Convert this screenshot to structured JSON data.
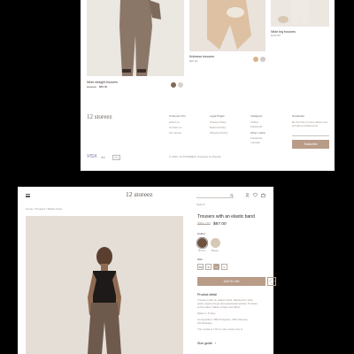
{
  "colors": {
    "accent": "#b89c88",
    "price_old": "#b2a89f",
    "text": "#3a3330"
  },
  "listing": {
    "products": [
      {
        "name": "Wide straight trousers",
        "price_old": "$100.00",
        "price": "$89.00",
        "swatches": [
          "#7d6a5a",
          "#d9d2c8"
        ]
      },
      {
        "name": "Knitwear trousers",
        "price": "$95.00",
        "swatches": [
          "#d8b48a",
          "#cfcac4"
        ]
      },
      {
        "name": "Wide leg trousers",
        "price": "$100.00"
      }
    ]
  },
  "footer": {
    "logo": "12 storeez",
    "cols": [
      {
        "title": "Customer info",
        "links": [
          "About us",
          "Contact us",
          "Our stores"
        ]
      },
      {
        "title": "Legal Pages",
        "links": [
          "Privacy Policy",
          "Refund Policy",
          "Shipping Policy"
        ]
      },
      {
        "title": "Instagram",
        "links": [
          "Twitter",
          "Facebook"
        ],
        "subtitle": "Other media",
        "sublinks": [
          "Facebook",
          "Youtube"
        ]
      },
      {
        "title": "Newsletter",
        "text": "Be the first to know about new arrivals and discounts",
        "placeholder": "Enter email",
        "button": "Subscribe"
      }
    ],
    "payments": [
      "VISA",
      "●●",
      "Pay"
    ],
    "copyright": "© 2023, 12 STOREEZ | Powered by Shopify"
  },
  "product": {
    "header": {
      "logo": "12 storeez",
      "search_placeholder": "Search"
    },
    "breadcrumb": "Home / Trousers / Elastic band",
    "title": "Trousers with an elastic band",
    "price_old": "$95.00",
    "price": "$67.00",
    "colour_label": "Colour",
    "colours": [
      {
        "name": "Brown",
        "hex": "#6e5240"
      },
      {
        "name": "Beige",
        "hex": "#d8c9b6"
      }
    ],
    "size_label": "Size",
    "sizes": [
      "XS",
      "S",
      "M",
      "L"
    ],
    "selected_size": "S",
    "add_to_cart": "Add To Cart",
    "detail_title": "Product detail",
    "detail_lines": [
      "Trousers with an elastic band. Relaxed fit, wide",
      "waist, tapered legs and elasticated ankles. Pockets",
      "at the sides. Made of light and fabric.",
      "Made in Turkey",
      "Composition: 68% Polyester, 30% Viscose,",
      "2% Elastane",
      "The model is 178 cm tall, wears size S"
    ],
    "size_guide": "Size guide"
  }
}
